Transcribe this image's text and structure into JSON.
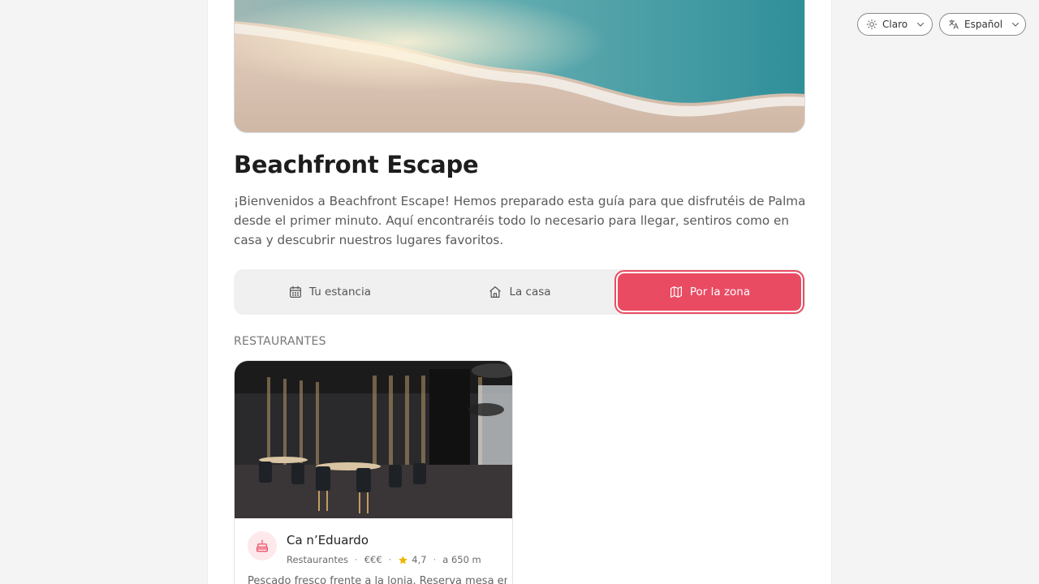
{
  "property": {
    "title": "Beachfront Escape",
    "intro": "¡Bienvenidos a Beachfront Escape! Hemos preparado esta guía para que disfrutéis de Palma desde el primer minuto. Aquí encontraréis todo lo necesario para llegar, sentiros como en casa y descubrir nuestros lugares favoritos."
  },
  "tabs": [
    {
      "label": "Tu estancia",
      "icon": "calendar-icon"
    },
    {
      "label": "La casa",
      "icon": "home-icon"
    },
    {
      "label": "Por la zona",
      "icon": "map-icon",
      "active": true
    }
  ],
  "section": {
    "title": "RESTAURANTES"
  },
  "places": [
    {
      "name": "Ca n’Eduardo",
      "category": "Restaurantes",
      "price": "€€€",
      "rating": "4,7",
      "distance": "a 650 m",
      "description": "Pescado fresco frente a la lonja. Reserva mesa en",
      "icon": "cake-icon"
    }
  ],
  "controls": {
    "theme": {
      "label": "Claro",
      "icon": "sun-icon"
    },
    "language": {
      "label": "Español",
      "icon": "translate-icon"
    }
  },
  "colors": {
    "accent": "#e94b63",
    "accent_soft": "#fde8ec",
    "star": "#f0b400"
  }
}
